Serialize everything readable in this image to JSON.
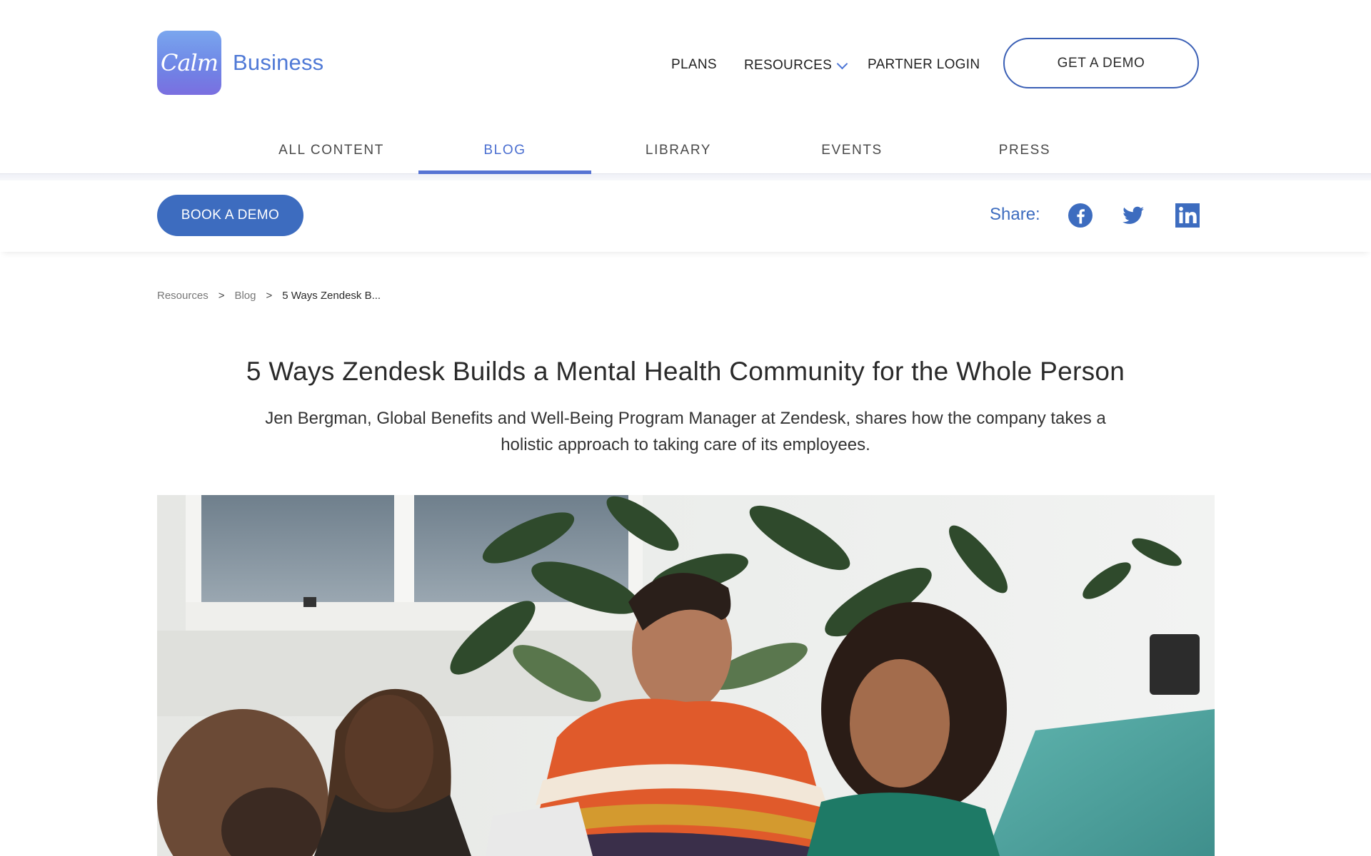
{
  "header": {
    "logo_tile_text": "Calm",
    "logo_word": "Business",
    "nav": {
      "plans": "PLANS",
      "resources": "RESOURCES",
      "partner_login": "PARTNER LOGIN"
    },
    "demo_button": "GET A DEMO"
  },
  "tabs": [
    {
      "label": "ALL CONTENT",
      "active": false
    },
    {
      "label": "BLOG",
      "active": true
    },
    {
      "label": "LIBRARY",
      "active": false
    },
    {
      "label": "EVENTS",
      "active": false
    },
    {
      "label": "PRESS",
      "active": false
    }
  ],
  "actionbar": {
    "book_demo": "BOOK A DEMO",
    "share_label": "Share:",
    "share_icons": [
      "facebook-icon",
      "twitter-icon",
      "linkedin-icon"
    ]
  },
  "breadcrumb": {
    "items": [
      "Resources",
      "Blog",
      "5 Ways Zendesk B..."
    ],
    "separator": ">"
  },
  "article": {
    "title": "5 Ways Zendesk Builds a Mental Health Community for the Whole Person",
    "subtitle": "Jen Bergman, Global Benefits and Well-Being Program Manager at Zendesk, shares how the company takes a holistic approach to taking care of its employees."
  },
  "colors": {
    "accent": "#3d6cbf",
    "tab_active": "#4a6ed0",
    "logo_gradient_top": "#7aa6ee",
    "logo_gradient_bottom": "#7a6fe0"
  }
}
